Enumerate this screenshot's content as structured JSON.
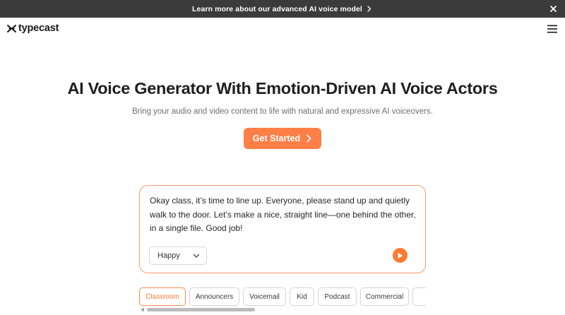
{
  "banner": {
    "text": "Learn more about our advanced AI voice model",
    "chevron_icon": "chevron-right-icon",
    "close_icon": "close-icon"
  },
  "header": {
    "logo_text": "typecast",
    "logo_icon": "typecast-logo-icon",
    "menu_icon": "hamburger-menu-icon"
  },
  "hero": {
    "title": "AI Voice Generator With Emotion-Driven AI Voice Actors",
    "subtitle": "Bring your audio and video content to life with natural and expressive AI voiceovers.",
    "cta_label": "Get Started",
    "cta_icon": "chevron-right-icon"
  },
  "voice_card": {
    "text": "Okay class, it’s time to line up. Everyone, please stand up and quietly walk to the door. Let’s make a nice, straight line—one behind the other, in a single file. Good job!",
    "emotion_selected": "Happy",
    "select_icon": "chevron-down-icon",
    "play_icon": "play-icon"
  },
  "categories": [
    {
      "label": "Classroom",
      "active": true
    },
    {
      "label": "Announcers",
      "active": false
    },
    {
      "label": "Voicemail",
      "active": false
    },
    {
      "label": "Kid",
      "active": false
    },
    {
      "label": "Podcast",
      "active": false
    },
    {
      "label": "Commercial",
      "active": false
    }
  ],
  "colors": {
    "accent": "#ff7f47",
    "banner_bg": "#3b3b3b",
    "card_border": "#ff9a6b",
    "text_dark": "#1f1f1f",
    "text_muted": "#6f6f6f"
  }
}
